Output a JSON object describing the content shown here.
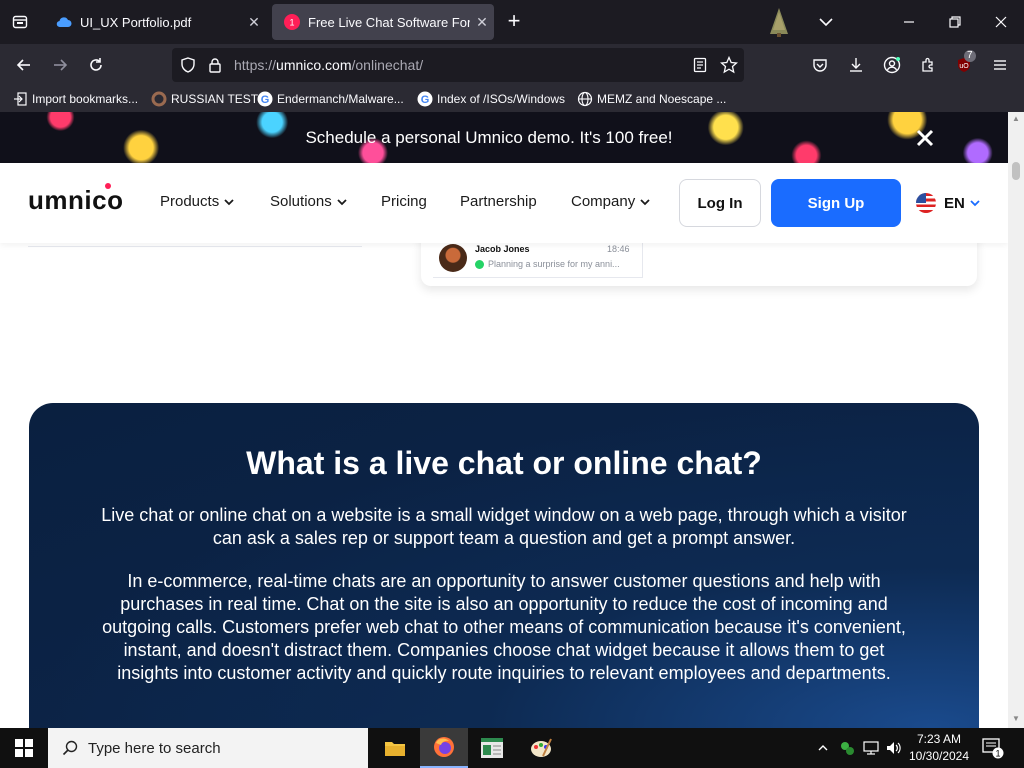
{
  "browser": {
    "tabs": [
      {
        "title": "UI_UX Portfolio.pdf",
        "active": false
      },
      {
        "title": "Free Live Chat Software For Wel",
        "active": true
      }
    ],
    "url": {
      "protocol": "https://",
      "domain": "umnico.com",
      "path": "/onlinechat/"
    },
    "extension_badge": "7",
    "bookmarks": [
      {
        "label": "Import bookmarks...",
        "icon": "import-icon"
      },
      {
        "label": "RUSSIAN TEST",
        "icon": "site-icon"
      },
      {
        "label": "Endermanch/Malware...",
        "icon": "google-icon"
      },
      {
        "label": "Index of /ISOs/Windows",
        "icon": "google-icon"
      },
      {
        "label": "MEMZ and Noescape ...",
        "icon": "globe-icon"
      }
    ]
  },
  "promo": {
    "text": "Schedule a personal Umnico demo. It's 100 free!"
  },
  "site_nav": {
    "logo": "umnico",
    "menu": [
      {
        "label": "Products",
        "has_dropdown": true
      },
      {
        "label": "Solutions",
        "has_dropdown": true
      },
      {
        "label": "Pricing",
        "has_dropdown": false
      },
      {
        "label": "Partnership",
        "has_dropdown": false
      },
      {
        "label": "Company",
        "has_dropdown": true
      }
    ],
    "login": "Log In",
    "signup": "Sign Up",
    "language": "EN"
  },
  "chat_preview": {
    "name": "Jacob Jones",
    "time": "18:46",
    "message": "Planning a surprise for my anni..."
  },
  "info": {
    "title": "What is a live chat or online chat?",
    "paragraphs": [
      "Live chat or online chat on a website is a small widget window on a web page, through which a visitor can ask a sales rep or support team a question and get a prompt answer.",
      "In e-commerce, real-time chats are an opportunity to answer customer questions and help with purchases in real time. Chat on the site is also an opportunity to reduce the cost of incoming and outgoing calls. Customers prefer web chat to other means of communication because it's convenient, instant, and doesn't distract them. Companies choose chat widget because it allows them to get insights into customer activity and quickly route inquiries to relevant employees and departments."
    ]
  },
  "taskbar": {
    "search_placeholder": "Type here to search",
    "time": "7:23 AM",
    "date": "10/30/2024",
    "notification_count": "1"
  },
  "colors": {
    "brand_blue": "#1a6cff",
    "brand_red": "#ff1f57",
    "card_navy": "#0c2448"
  }
}
